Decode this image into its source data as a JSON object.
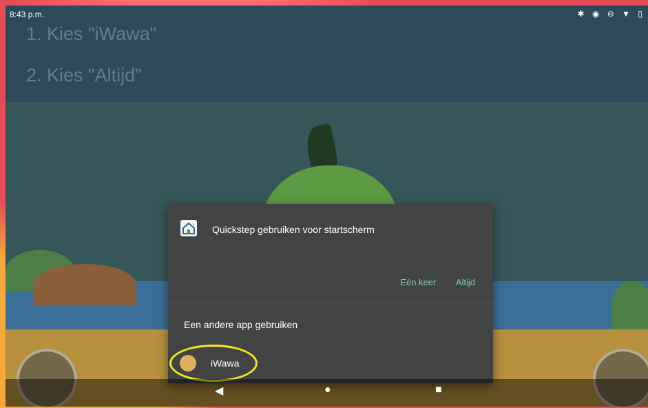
{
  "status_bar": {
    "time": "8:43 p.m.",
    "icons": [
      "bluetooth-icon",
      "vibrate-icon",
      "do-not-disturb-icon",
      "wifi-icon",
      "battery-icon"
    ]
  },
  "instructions": {
    "step1": "1. Kies \"iWawa\"",
    "step2": "2. Kies \"Altijd\""
  },
  "dialog": {
    "title": "Quickstep gebruiken voor startscherm",
    "once_label": "Eén keer",
    "always_label": "Altijd",
    "other_app_label": "Een andere app gebruiken",
    "app_name": "iWawa"
  },
  "nav": {
    "back": "◀",
    "home": "●",
    "recents": "■"
  },
  "colors": {
    "dialog_bg": "#424343",
    "accent": "#80cbc4",
    "highlight": "#f2ea1a",
    "outer_bg": "#e54c58"
  }
}
